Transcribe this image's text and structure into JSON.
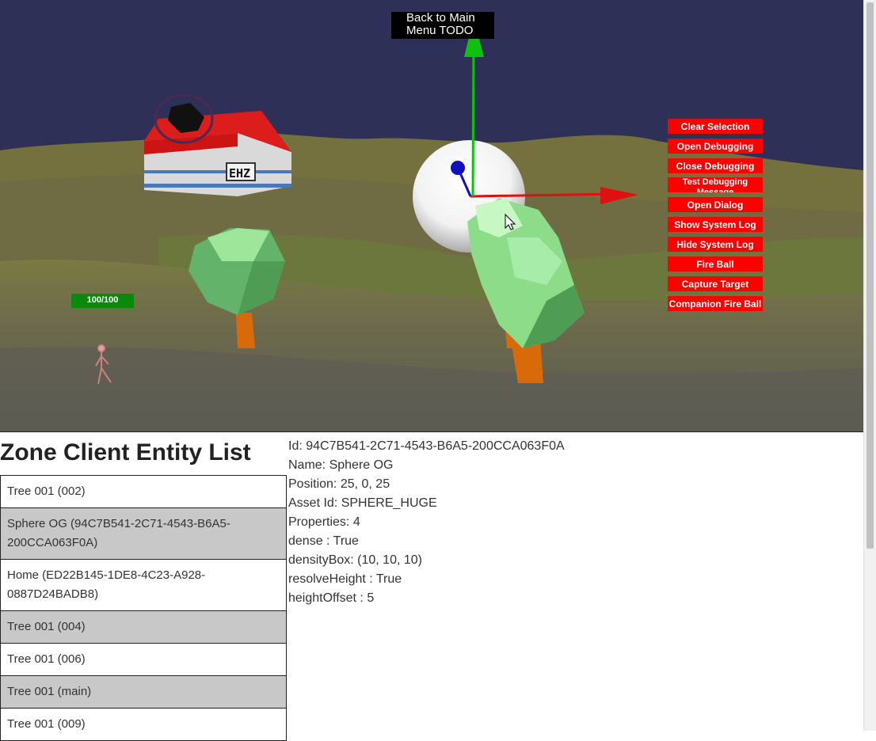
{
  "viewport": {
    "back_button": "Back to Main\nMenu TODO",
    "health": "100/100",
    "sign_text": "EHZ",
    "action_buttons": [
      {
        "label": "Clear Selection"
      },
      {
        "label": "Open Debugging"
      },
      {
        "label": "Close Debugging"
      },
      {
        "label": "Test Debugging\nMessage"
      },
      {
        "label": "Open Dialog"
      },
      {
        "label": "Show System Log"
      },
      {
        "label": "Hide System Log"
      },
      {
        "label": "Fire Ball"
      },
      {
        "label": "Capture Target"
      },
      {
        "label": "Companion Fire Ball"
      }
    ]
  },
  "entity_list": {
    "title": "Zone Client Entity List",
    "items": [
      {
        "label": "Tree 001 (002)"
      },
      {
        "label": "Sphere OG (94C7B541-2C71-4543-B6A5-200CCA063F0A)"
      },
      {
        "label": "Home (ED22B145-1DE8-4C23-A928-0887D24BADB8)"
      },
      {
        "label": "Tree 001 (004)"
      },
      {
        "label": "Tree 001 (006)"
      },
      {
        "label": "Tree 001 (main)"
      },
      {
        "label": "Tree 001 (009)"
      }
    ]
  },
  "details": {
    "id": "Id: 94C7B541-2C71-4543-B6A5-200CCA063F0A",
    "name": "Name: Sphere OG",
    "position": "Position: 25, 0, 25",
    "asset_id": "Asset Id: SPHERE_HUGE",
    "properties": "Properties: 4",
    "dense": "dense : True",
    "density_box": "densityBox: (10, 10, 10)",
    "resolve_height": "resolveHeight : True",
    "height_offset": "heightOffset : 5"
  },
  "colors": {
    "sky": "#2e3057",
    "action_button": "#ff0000",
    "health_bar": "#0a8a0a",
    "gizmo_x": "#e01010",
    "gizmo_y": "#10c010",
    "gizmo_z": "#1010c0",
    "selected_row": "#c8c8c8"
  }
}
